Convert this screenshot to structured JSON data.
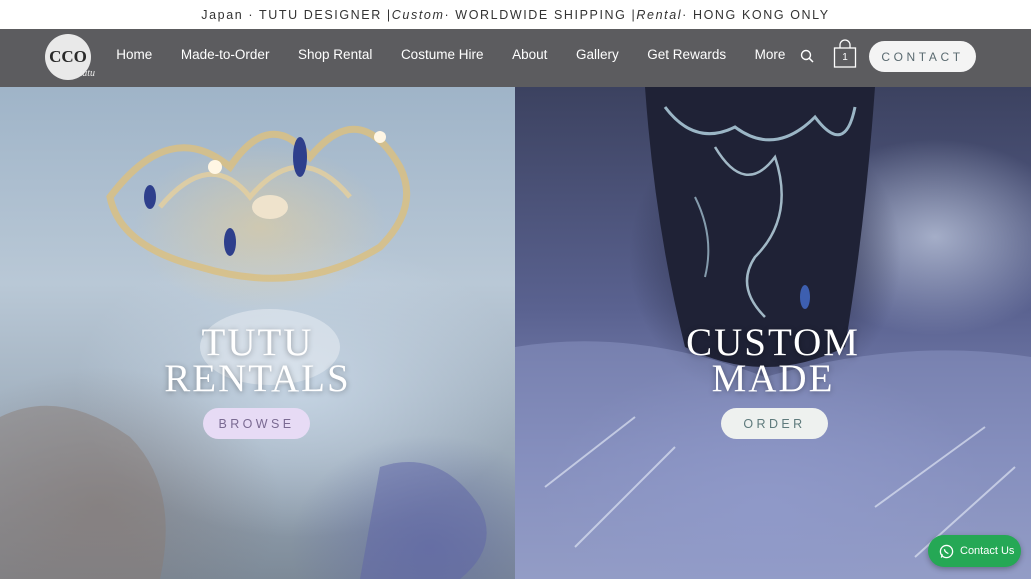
{
  "announcement": {
    "part1": "Japan · TUTU DESIGNER | ",
    "part2": "Custom",
    "part3": " · WORLDWIDE SHIPPING | ",
    "part4": "Rental",
    "part5": " · HONG KONG ONLY"
  },
  "logo": {
    "mark": "CCO",
    "sub": "tutu"
  },
  "nav": {
    "items": [
      "Home",
      "Made-to-Order",
      "Shop Rental",
      "Costume Hire",
      "About",
      "Gallery",
      "Get Rewards",
      "More"
    ],
    "cart_count": "1",
    "contact_label": "CONTACT"
  },
  "hero_left": {
    "title_line1": "TUTU",
    "title_line2": "RENTALS",
    "button": "BROWSE"
  },
  "hero_right": {
    "title_line1": "CUSTOM",
    "title_line2": "MADE",
    "button": "ORDER"
  },
  "chat": {
    "label": "Contact Us"
  },
  "icons": {
    "search": "search-icon",
    "cart": "shopping-bag-icon",
    "chat": "whatsapp-icon"
  },
  "colors": {
    "nav_bg": "#5c5c5f",
    "browse_bg": "#e7dbf5",
    "order_bg": "#eef1ef",
    "chat_bg": "#25a855"
  }
}
